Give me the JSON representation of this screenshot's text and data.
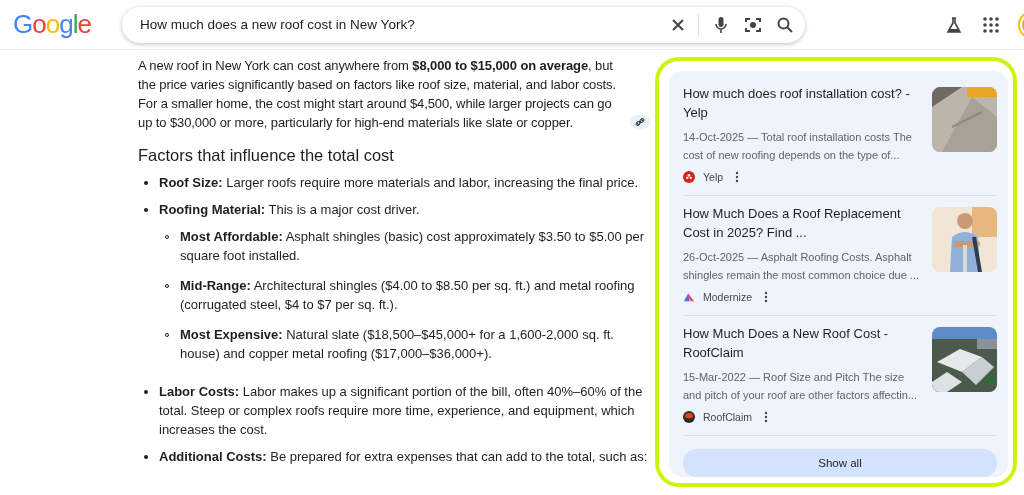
{
  "logo": "Google",
  "search": {
    "value": "How much does a new roof cost in New York?"
  },
  "answer": {
    "intro": "A new roof in New York can cost anywhere from **$8,000 to $15,000 on average**, but the price varies significantly based on factors like roof size, material, and labor costs. For a smaller home, the cost might start around $4,500, while larger projects can go up to $30,000 or more, particularly for high-end materials like slate or copper.",
    "heading": "Factors that influence the total cost",
    "items": [
      {
        "text": "**Roof Size:** Larger roofs require more materials and labor, increasing the final price."
      },
      {
        "text": "**Roofing Material:** This is a major cost driver.",
        "children": [
          {
            "text": "**Most Affordable:** Asphalt shingles (basic) cost approximately $3.50 to $5.00 per square foot installed."
          },
          {
            "text": "**Mid-Range:** Architectural shingles ($4.00 to $8.50 per sq. ft.) and metal roofing (corrugated steel, $4 to $7 per sq. ft.)."
          },
          {
            "text": "**Most Expensive:** Natural slate ($18,500–$45,000+ for a 1,600-2,000 sq. ft. house) and copper metal roofing ($17,000–$36,000+)."
          }
        ]
      },
      {
        "text": "**Labor Costs:** Labor makes up a significant portion of the bill, often 40%–60% of the total. Steep or complex roofs require more time, experience, and equipment, which increases the cost."
      },
      {
        "text": "**Additional Costs:** Be prepared for extra expenses that can add to the total, such as:"
      }
    ]
  },
  "sources": [
    {
      "title": "How much does roof installation cost? - Yelp",
      "snippet": "14-Oct-2025 — Total roof installation costs The cost of new roofing depends on the type of...",
      "site": "Yelp"
    },
    {
      "title": "How Much Does a Roof Replacement Cost in 2025? Find ...",
      "snippet": "26-Oct-2025 — Asphalt Roofing Costs. Asphalt shingles remain the most common choice due ...",
      "site": "Modernize"
    },
    {
      "title": "How Much Does a New Roof Cost - RoofClaim",
      "snippet": "15-Mar-2022 — Roof Size and Pitch The size and pitch of your roof are other factors affectin...",
      "site": "RoofClaim"
    }
  ],
  "show_all": "Show all"
}
